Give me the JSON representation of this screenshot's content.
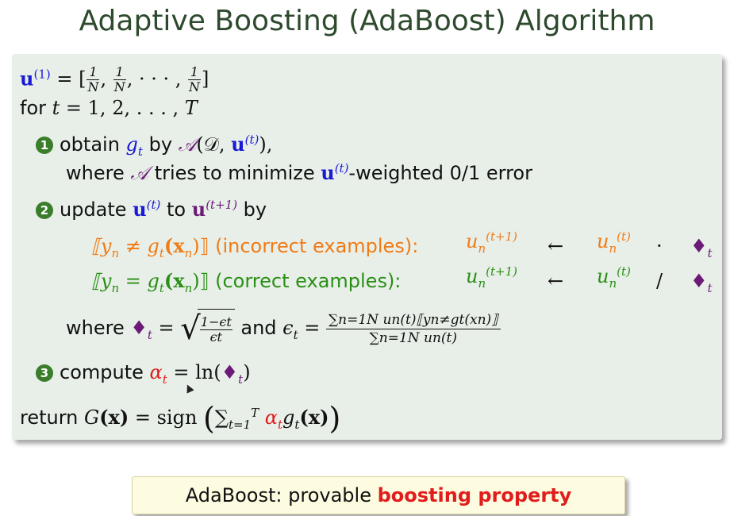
{
  "title": "Adaptive Boosting (AdaBoost) Algorithm",
  "init": {
    "u1": "u",
    "sup1": "(1)",
    "eq": " = [",
    "f_num": "1",
    "f_den": "N",
    "sep": ", ",
    "dots": "· · · ",
    "close": "]"
  },
  "loop": {
    "for": "for ",
    "t": "t",
    "range": " = 1, 2, . . . , ",
    "T": "T"
  },
  "steps": {
    "s1": {
      "num": "1",
      "text": "obtain ",
      "g": "g",
      "sub_t": "t",
      "by": " by ",
      "A": "𝒜",
      "args": "(𝒟, ",
      "u": "u",
      "sup_t": "(t)",
      "close": "),",
      "where": "where ",
      "A2": "𝒜",
      "tries": " tries to minimize ",
      "u2": "u",
      "sup_t2": "(t)",
      "weighted": "-weighted 0/1 error"
    },
    "s2": {
      "num": "2",
      "text": "update ",
      "u": "u",
      "sup_t": "(t)",
      "to": " to ",
      "u2": "u",
      "sup_t1": "(t+1)",
      "by": " by"
    },
    "incorrect": {
      "cond": "⟦y",
      "n": "n",
      "neq": " ≠ g",
      "t": "t",
      "x": "(x",
      "xn": "n",
      "close": ")⟧",
      "label": " (incorrect examples):",
      "lhs": "u",
      "lhs_sub": "n",
      "lhs_sup": "(t+1)",
      "arrow": "←",
      "rhs": "u",
      "rhs_sub": "n",
      "rhs_sup": "(t)",
      "op": "·",
      "diamond": "♦",
      "d_sub": "t"
    },
    "correct": {
      "cond": "⟦y",
      "n": "n",
      "eq": " = g",
      "t": "t",
      "x": "(x",
      "xn": "n",
      "close": ")⟧",
      "label": " (correct examples):",
      "lhs": "u",
      "lhs_sub": "n",
      "lhs_sup": "(t+1)",
      "arrow": "←",
      "rhs": "u",
      "rhs_sub": "n",
      "rhs_sup": "(t)",
      "op": "/",
      "diamond": "♦",
      "d_sub": "t"
    },
    "where": {
      "where": "where ",
      "diamond": "♦",
      "d_sub": "t",
      "eq": " = ",
      "sq_num": "1−ϵt",
      "sq_den": "ϵt",
      "and": " and ",
      "eps": "ϵ",
      "eps_sub": "t",
      "eq2": " = ",
      "big_num": "∑n=1N un(t)⟦yn≠gt(xn)⟧",
      "big_den": "∑n=1N un(t)"
    },
    "s3": {
      "num": "3",
      "text": "compute ",
      "alpha": "α",
      "a_sub": "t",
      "eq": " = ln(",
      "diamond": "♦",
      "d_sub": "t",
      "close": ")"
    }
  },
  "ret": {
    "text": "return ",
    "G": "G",
    "x": "(x)",
    "eq": " = sign ",
    "open": "(",
    "sum": "∑",
    "sum_lim": "t=1",
    "sum_T": "T",
    "alpha": " α",
    "a_sub": "t",
    "g": "g",
    "g_sub": "t",
    "gx": "(x)",
    "close": ")"
  },
  "callout": {
    "prefix": "AdaBoost: provable ",
    "highlight": "boosting property"
  },
  "colors": {
    "title": "#2e4a2e",
    "box": "#e8efe8",
    "blue": "#1a1ad6",
    "purple": "#6b1a78",
    "red": "#e11c1c",
    "orange": "#f07b17",
    "green": "#2a8f16"
  }
}
